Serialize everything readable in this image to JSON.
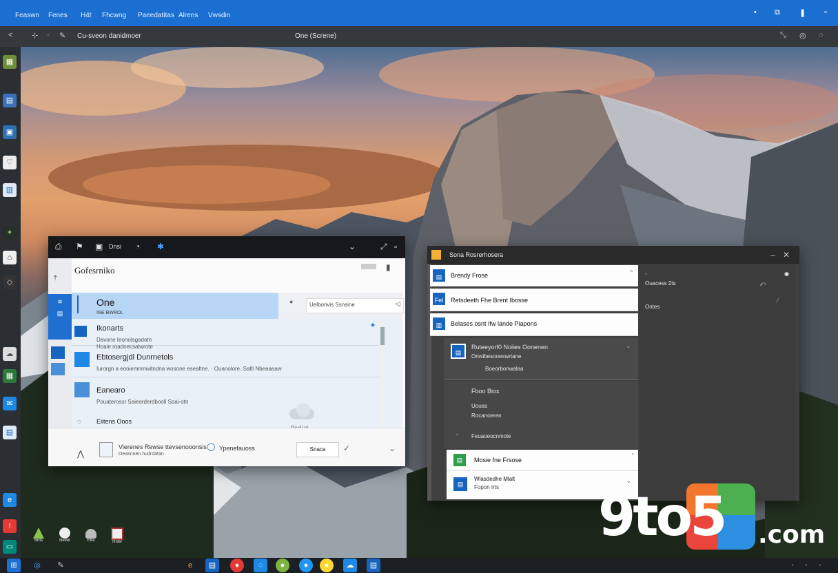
{
  "menubar": {
    "items": [
      "Feaswn",
      "Fenes",
      "H4t",
      "Fhcwng",
      "Paeedatitas",
      "Alrens",
      "Vwsdin"
    ],
    "right_icons": [
      "dot-icon",
      "notification-icon",
      "pause-icon"
    ]
  },
  "toolbar": {
    "title": "Cu-sveon danidmoer",
    "center_title": "One (Screne)"
  },
  "windowA": {
    "title_icons": [
      "save-icon",
      "bookmark-icon",
      "square-icon",
      "Dnsi",
      "clock-icon",
      "star-icon"
    ],
    "header": "Gofesrniko",
    "selected": {
      "title": "One",
      "sub": "INE BWRDL"
    },
    "tab_label": "Uelbonvis Ssnsine",
    "rows": [
      {
        "title": "Ikonarts",
        "sub": "Davone Ieonolsgadotn",
        "sub2": "Hoaie roadoecsalwrote"
      },
      {
        "title": "Ebtosergjdl Dunrnetols",
        "sub": "Iurorgn a eooiemnmwitndna wosone esealtne. · Ouanolore. Saltl Nbeaaaaw"
      },
      {
        "title": "Eanearo",
        "sub": "Pouaterossr Saieorderdbooll Soai-otn"
      }
    ],
    "bottom_left": "Eiitens Ooos",
    "cloud_label": "Pecli ki",
    "footer": {
      "text": "Vierenes Rewse ttevsenooonsis",
      "text2": "Oeasnnen hudrdatan",
      "right_text": "Ypenefauoss",
      "button": "Snaca"
    }
  },
  "windowB": {
    "title": "Sona Rosrerhosera",
    "rows": [
      {
        "label": "Brendy Frose"
      },
      {
        "label": "Retsdeeth Fhe Brent Ibosse"
      },
      {
        "label": "Belases osnt Ifw lande Piapons"
      }
    ],
    "dark_section": {
      "title": "Ruteeyorf0 Noiies Oonenen",
      "sub": "Onwibesooeswrtane",
      "sub2": "Boeorbonwalaa"
    },
    "panel_right": [
      "Ouacess 2ts",
      "Ontes"
    ],
    "list": {
      "heading": "Fboo Biox",
      "items": [
        "Uouas",
        "Rocanoeren",
        "Feuaoeocnmole"
      ]
    },
    "footer_rows": [
      {
        "label": "Mosie fne Frsose"
      },
      {
        "label": "Wlasdedhe Mlalt",
        "sub": "Fopon Irts"
      }
    ]
  },
  "desktop_icons": [
    "Bnts",
    "Nevet",
    "Etre",
    "Hntiv"
  ],
  "logo": {
    "text1": "9to5",
    "text2": ".com"
  },
  "colors": {
    "accent": "#1a6fd0",
    "title_dark": "#16181b",
    "selection": "#b8d6f5",
    "logo_orange": "#f2762e",
    "logo_red": "#e9453a",
    "logo_green": "#4caf50",
    "logo_blue": "#2d8fe0"
  }
}
